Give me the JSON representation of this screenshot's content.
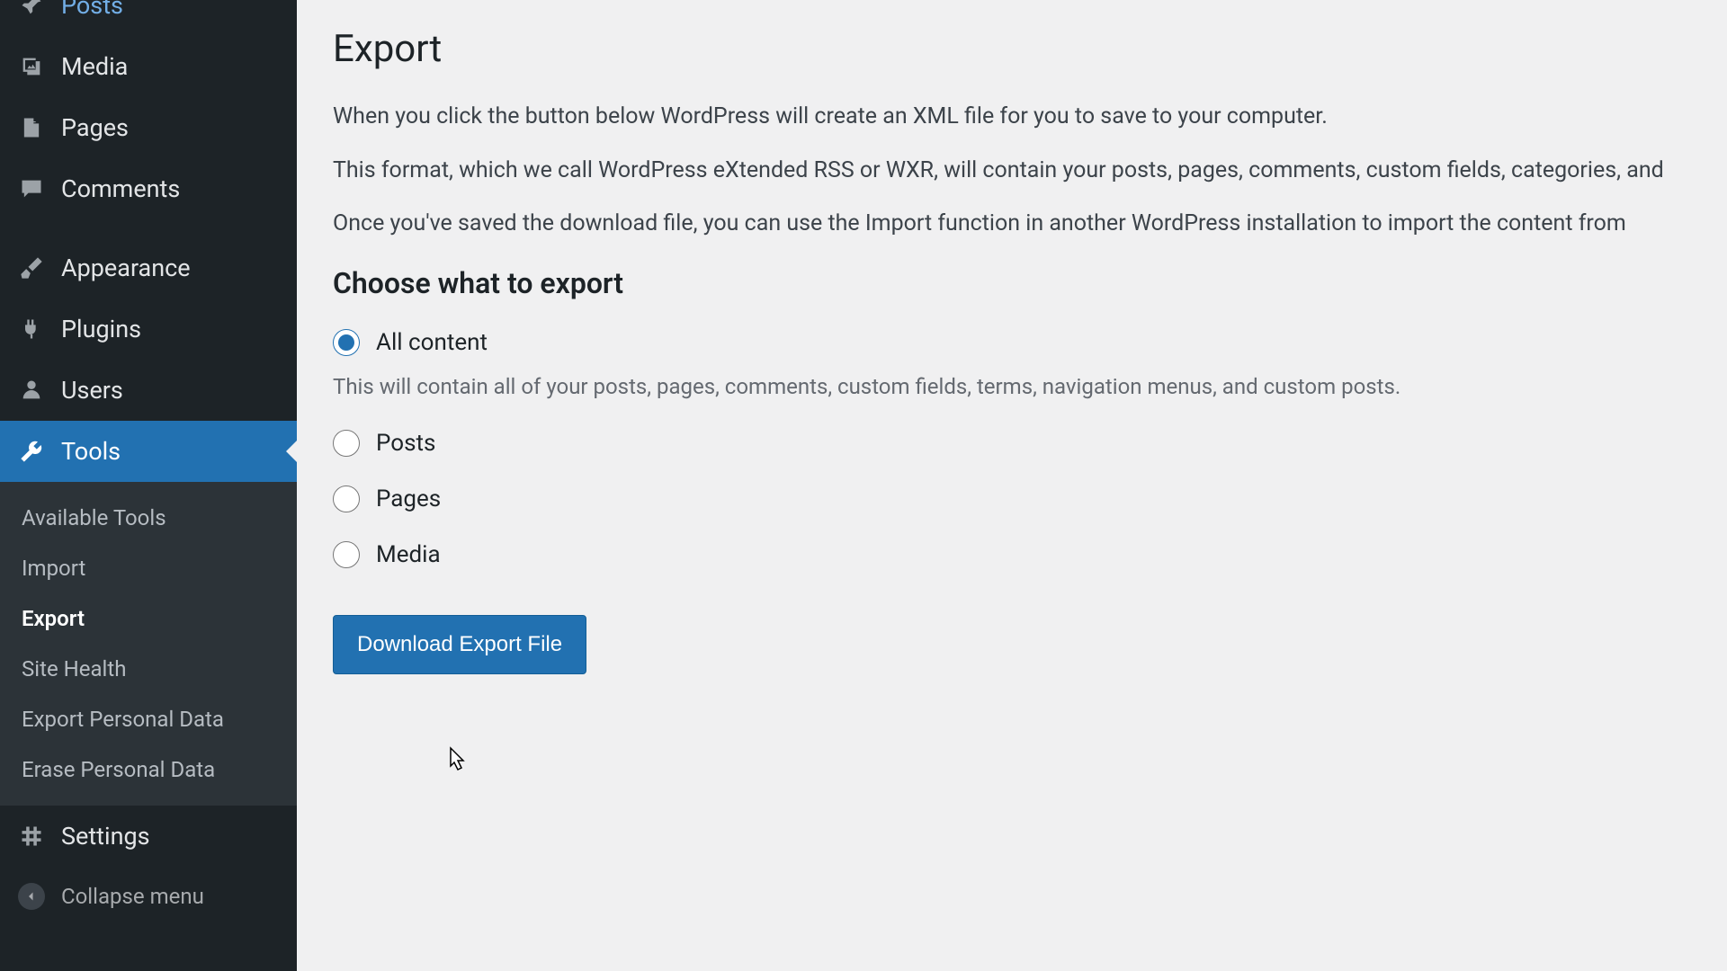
{
  "sidebar": {
    "items": [
      {
        "id": "posts",
        "label": "Posts",
        "icon": "pin"
      },
      {
        "id": "media",
        "label": "Media",
        "icon": "media"
      },
      {
        "id": "pages",
        "label": "Pages",
        "icon": "page"
      },
      {
        "id": "comments",
        "label": "Comments",
        "icon": "comment"
      },
      {
        "id": "separator1",
        "separator": true
      },
      {
        "id": "appearance",
        "label": "Appearance",
        "icon": "brush"
      },
      {
        "id": "plugins",
        "label": "Plugins",
        "icon": "plug"
      },
      {
        "id": "users",
        "label": "Users",
        "icon": "user"
      },
      {
        "id": "tools",
        "label": "Tools",
        "icon": "wrench",
        "active": true
      },
      {
        "id": "settings",
        "label": "Settings",
        "icon": "settings"
      }
    ],
    "tools_submenu": [
      {
        "id": "available-tools",
        "label": "Available Tools"
      },
      {
        "id": "import",
        "label": "Import"
      },
      {
        "id": "export",
        "label": "Export",
        "current": true
      },
      {
        "id": "site-health",
        "label": "Site Health"
      },
      {
        "id": "export-personal",
        "label": "Export Personal Data"
      },
      {
        "id": "erase-personal",
        "label": "Erase Personal Data"
      }
    ],
    "collapse_label": "Collapse menu"
  },
  "main": {
    "title": "Export",
    "intro1": "When you click the button below WordPress will create an XML file for you to save to your computer.",
    "intro2": "This format, which we call WordPress eXtended RSS or WXR, will contain your posts, pages, comments, custom fields, categories, and",
    "intro3": "Once you've saved the download file, you can use the Import function in another WordPress installation to import the content from",
    "section_title": "Choose what to export",
    "radios": [
      {
        "id": "all",
        "label": "All content",
        "checked": true,
        "desc": "This will contain all of your posts, pages, comments, custom fields, terms, navigation menus, and custom posts."
      },
      {
        "id": "posts",
        "label": "Posts"
      },
      {
        "id": "pages",
        "label": "Pages"
      },
      {
        "id": "media",
        "label": "Media"
      }
    ],
    "download_label": "Download Export File"
  }
}
